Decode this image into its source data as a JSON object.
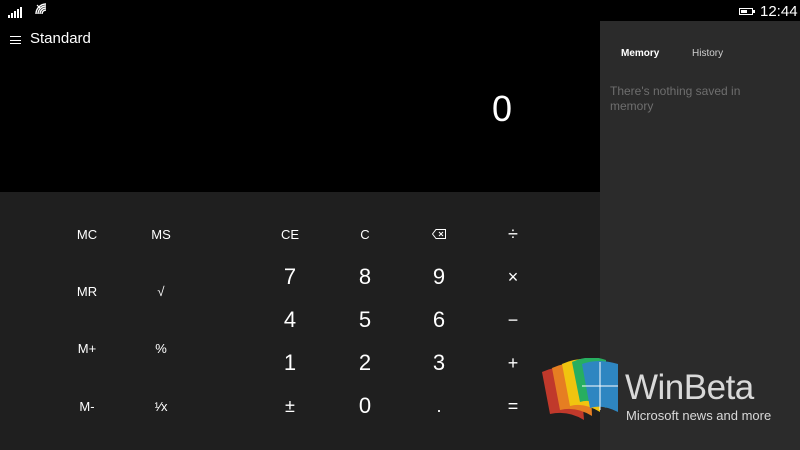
{
  "status_bar": {
    "time": "12:44",
    "battery_level": 0.6,
    "icons": [
      "signal-icon",
      "wifi-icon",
      "battery-icon"
    ]
  },
  "header": {
    "mode_title": "Standard",
    "menu_icon": "hamburger-icon"
  },
  "display": {
    "value": "0"
  },
  "memory_keys": [
    "MC",
    "MS",
    "MR",
    "√",
    "M+",
    "%",
    "M-",
    "¹⁄x"
  ],
  "keypad": {
    "row1": [
      "CE",
      "C",
      "⌫",
      "÷"
    ],
    "row2": [
      "7",
      "8",
      "9",
      "×"
    ],
    "row3": [
      "4",
      "5",
      "6",
      "−"
    ],
    "row4": [
      "1",
      "2",
      "3",
      "+"
    ],
    "row5": [
      "±",
      "0",
      ".",
      "="
    ]
  },
  "side_panel": {
    "tabs": [
      "Memory",
      "History"
    ],
    "active_tab": "Memory",
    "empty_message": "There's nothing saved in memory"
  },
  "watermark": {
    "title": "WinBeta",
    "subtitle": "Microsoft news and more",
    "colors": [
      "#c0392b",
      "#e67e22",
      "#f1c40f",
      "#27ae60",
      "#2e86c1"
    ]
  },
  "colors": {
    "keypad_bg": "#1f1f1f",
    "panel_bg": "#2b2b2b",
    "display_bg": "#000000"
  }
}
